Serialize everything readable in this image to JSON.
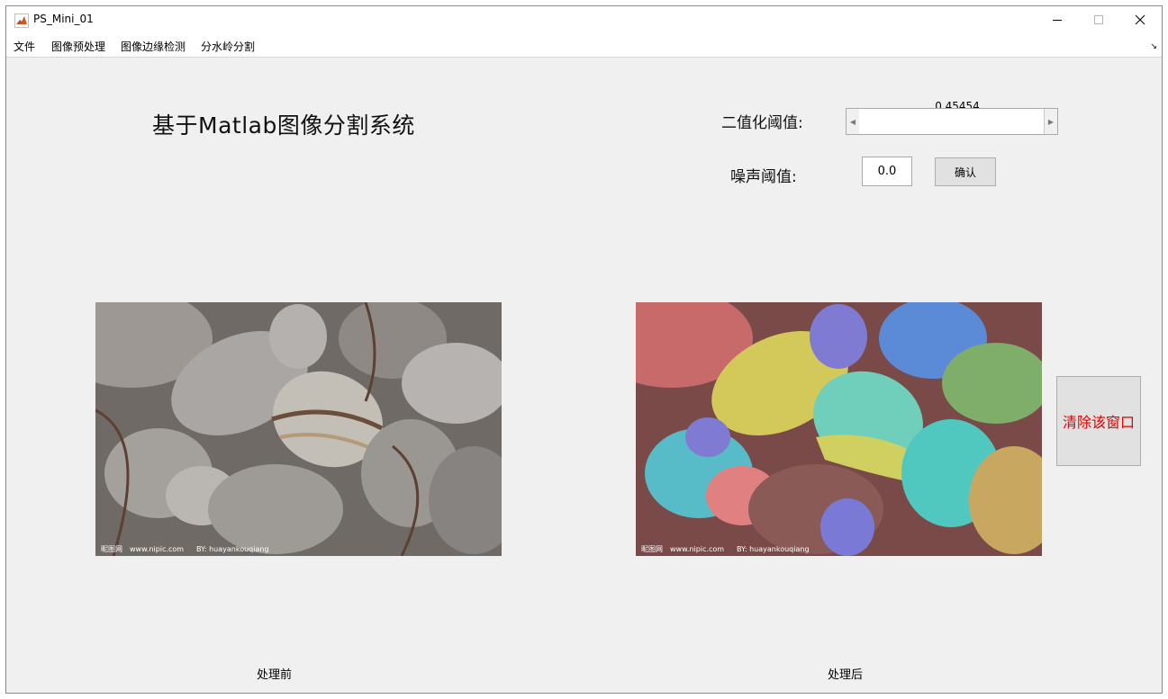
{
  "window": {
    "title": "PS_Mini_01",
    "controls": [
      "minimize-icon",
      "maximize-icon",
      "close-icon"
    ]
  },
  "menu": {
    "items": [
      "文件",
      "图像预处理",
      "图像边缘检测",
      "分水岭分割"
    ],
    "corner": "↘"
  },
  "main": {
    "title": "基于Matlab图像分割系统",
    "binarize_label": "二值化阈值:",
    "slider_value": "0.45454",
    "slider_level": 0.45454,
    "noise_label": "噪声阈值:",
    "noise_value": "0.0",
    "confirm_label": "确认",
    "clear_label": "清除该窗口",
    "before_caption": "处理前",
    "after_caption": "处理后",
    "watermark": {
      "site": "www.nipic.com",
      "author": "BY: huayankouqiang",
      "logo": "昵图网"
    }
  },
  "colors": {
    "clear_text": "#e00000",
    "panel_bg": "#f0f0f0",
    "button_bg": "#e1e1e1"
  }
}
